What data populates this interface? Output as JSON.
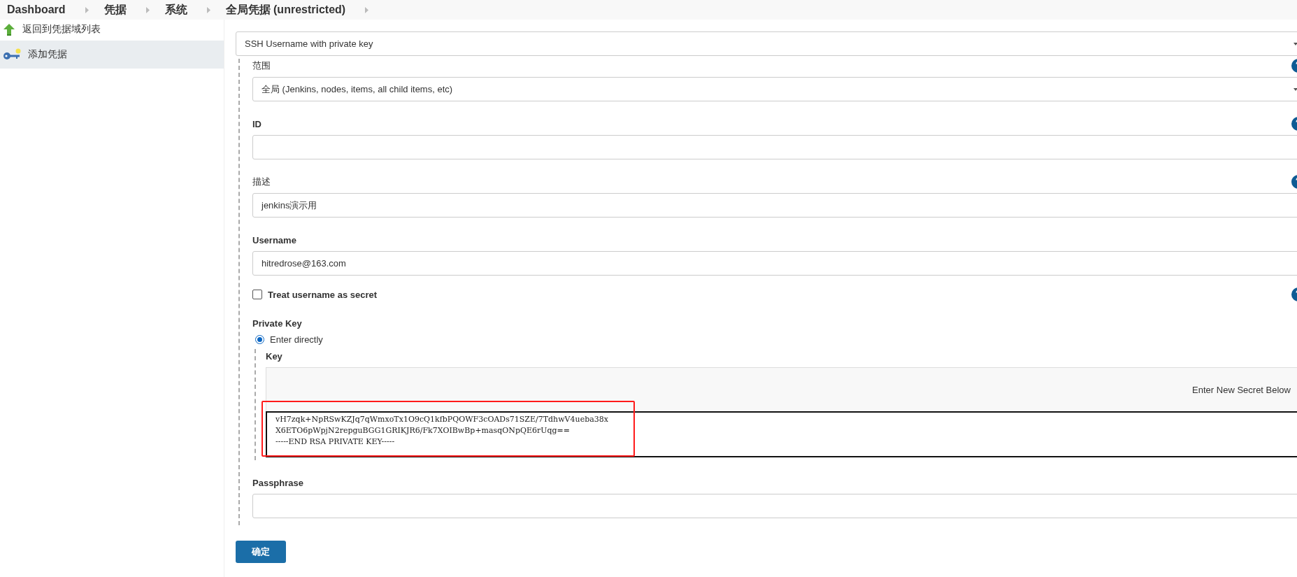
{
  "breadcrumbs": [
    {
      "label": "Dashboard"
    },
    {
      "label": "凭据"
    },
    {
      "label": "系统"
    },
    {
      "label": "全局凭据 (unrestricted)"
    }
  ],
  "sidebar": {
    "items": [
      {
        "label": "返回到凭据域列表",
        "selected": false
      },
      {
        "label": "添加凭据",
        "selected": true
      }
    ]
  },
  "form": {
    "type_select": {
      "value": "SSH Username with private key"
    },
    "fields": [
      {
        "kind": "select",
        "label": "范围",
        "value": "全局 (Jenkins, nodes, items, all child items, etc)",
        "help": true
      },
      {
        "kind": "text",
        "label": "ID",
        "help": true
      },
      {
        "kind": "text",
        "label": "描述",
        "value": "jenkins演示用",
        "help": true
      },
      {
        "kind": "text",
        "label": "Username",
        "value": "hitredrose@163.com",
        "help": false
      },
      {
        "kind": "checkbox",
        "label": "Treat username as secret",
        "checked": false,
        "help": true
      },
      {
        "kind": "private_key",
        "label": "Private Key",
        "option": {
          "label": "Enter directly",
          "selected": true
        },
        "key_label": "Key",
        "secret_hint": "Enter New Secret Below",
        "highlighted": true,
        "key_lines": [
          "vH7zqk+NpRSwKZJq7qWmxoTx1O9cQ1kfbPQOWF3cOADs71SZE/7TdhwV4ueba38x",
          "X6ETO6pWpjN2repguBGG1GRIKJR6/Fk7XOIBwBp+masqONpQE6rUqg==",
          "-----END RSA PRIVATE KEY-----"
        ]
      },
      {
        "kind": "text",
        "label": "Passphrase",
        "help": false
      }
    ],
    "submit": "确定"
  }
}
